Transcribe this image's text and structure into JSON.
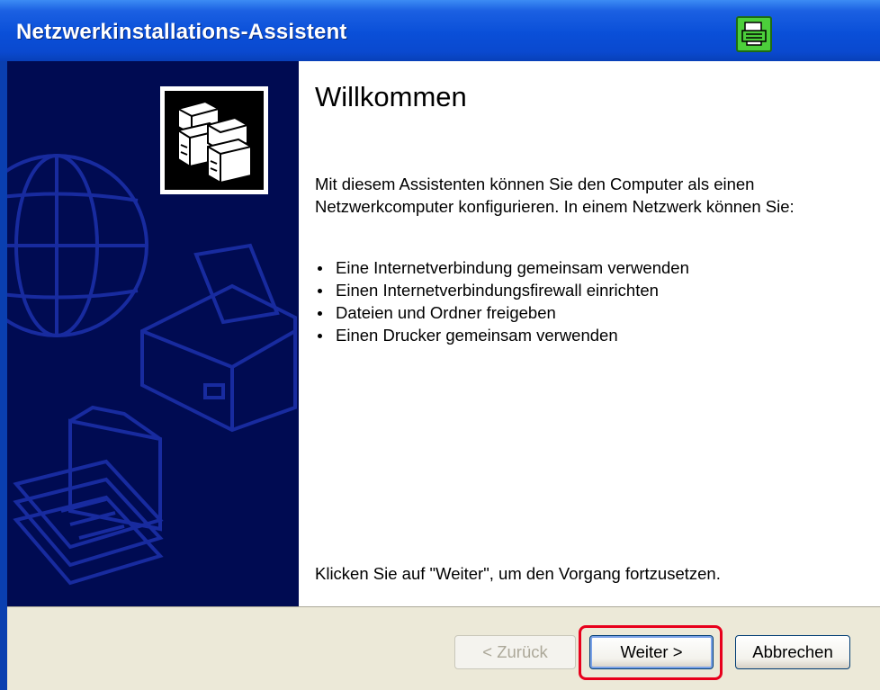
{
  "window": {
    "title": "Netzwerkinstallations-Assistent"
  },
  "page": {
    "heading": "Willkommen",
    "intro": "Mit diesem Assistenten können Sie den Computer als einen Netzwerkcomputer konfigurieren. In einem Netzwerk können Sie:",
    "bullets": [
      "Eine Internetverbindung gemeinsam verwenden",
      "Einen Internetverbindungsfirewall einrichten",
      "Dateien und Ordner freigeben",
      "Einen Drucker gemeinsam verwenden"
    ],
    "footer": "Klicken Sie auf \"Weiter\", um den Vorgang fortzusetzen."
  },
  "buttons": {
    "back": "< Zurück",
    "next": "Weiter >",
    "cancel": "Abbrechen"
  },
  "icons": {
    "title": "network-printer-icon",
    "wizard": "network-computers-icon"
  },
  "colors": {
    "titlebar": "#0a4fd8",
    "banner": "#000b52",
    "highlight": "#e8001c"
  }
}
